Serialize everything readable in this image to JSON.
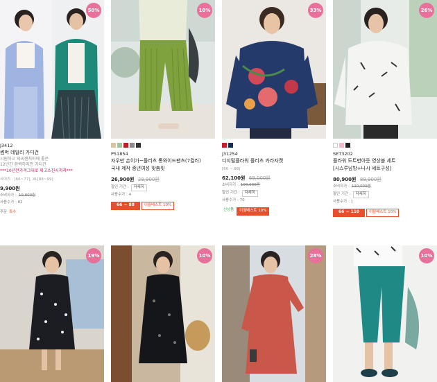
{
  "products_top": [
    {
      "badge": "50%",
      "code": "J3412",
      "name": "썸머 데일리 가디건",
      "desc1": "시원하고 외씨센처마에 좋은",
      "desc2": "12년간 완벽하지만 가디건",
      "promo": "***10년전가격그대로 제고소진시까지***",
      "size_line": "사이즈 : [66~77], XL[88~99]",
      "price": "9,900원",
      "consumer_label": "소비자가 :",
      "consumer_price": "19,800원",
      "buy_label": "사용수가 : 82",
      "stock_label": "주문",
      "stock_value": "특수"
    },
    {
      "badge": "10%",
      "swatches": [
        "#d9c4a0",
        "#9cc79a",
        "#b8232a",
        "#8a8a8a",
        "#333333"
      ],
      "code": "P51854",
      "name": "자우만 손이가~플리츠 통와이드팬츠(7컬러)",
      "name2": "국내 제작 중년여성 맞춤핏",
      "price": "26,900원",
      "orig_price": "29,900원",
      "period_label": "할인 기간 :",
      "period_value": "자세히",
      "buy_label": "사용수가 : 4",
      "tag_size": "66 ~ 88",
      "tag_event": "이월베스트 10%"
    },
    {
      "badge": "33%",
      "swatches": [
        "#c0242a",
        "#1e2a55"
      ],
      "code": "J31254",
      "name": "디지털플라워 플리츠 카라자켓",
      "size_line": "[66 ~ 88]",
      "price": "62,100원",
      "orig_price": "69,000원",
      "consumer_label": "소비자가 :",
      "consumer_price": "100,000원",
      "period_label": "할인 기간 :",
      "period_value": "자세히",
      "buy_label": "사용수가 : 70",
      "tag_new": "신상품",
      "tag_event": "이월베스트 10%"
    },
    {
      "badge": "26%",
      "swatches": [
        "#ffffff",
        "#f2b8c8",
        "#222222"
      ],
      "code": "SET3202",
      "name": "플라워 도트번아웃 영상블 세트",
      "name2": "[시스루남방+나시 세트구성]",
      "price": "80,900원",
      "orig_price": "89,900원",
      "consumer_label": "소비자가 :",
      "consumer_price": "110,000원",
      "period_label": "할인 기간 :",
      "period_value": "자세히",
      "buy_label": "사용수가 : 1",
      "tag_size": "66 ~ 110",
      "tag_event": "이월베스트 10%"
    }
  ],
  "products_bottom": [
    {
      "badge": "19%"
    },
    {
      "badge": "10%"
    },
    {
      "badge": "28%"
    },
    {
      "badge": "10%"
    }
  ]
}
